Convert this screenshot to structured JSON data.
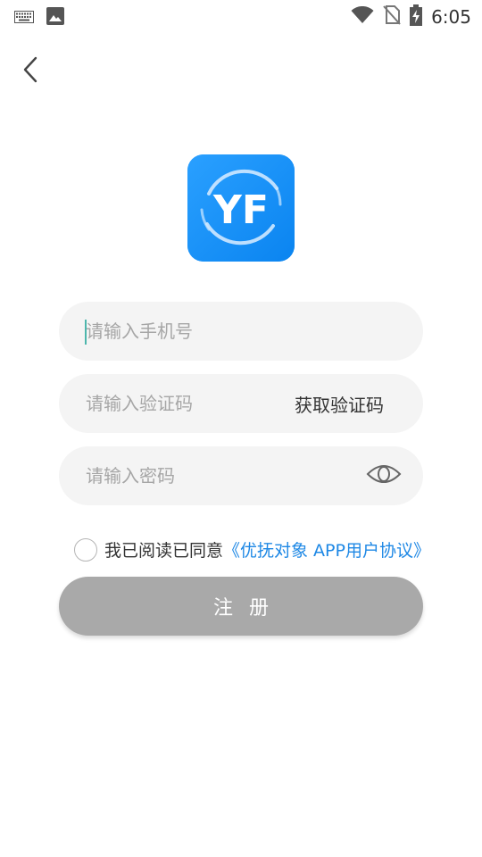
{
  "status_bar": {
    "time": "6:05",
    "icons": [
      "keyboard-icon",
      "image-icon",
      "wifi-icon",
      "no-sim-icon",
      "battery-charging-icon"
    ]
  },
  "nav": {
    "back_icon": "chevron-left-icon"
  },
  "logo": {
    "text": "YF",
    "bg_color": "#1e90f5"
  },
  "form": {
    "phone_placeholder": "请输入手机号",
    "code_placeholder": "请输入验证码",
    "get_code_label": "获取验证码",
    "password_placeholder": "请输入密码",
    "eye_icon": "eye-icon"
  },
  "agreement": {
    "prefix": "我已阅读已同意",
    "link_text": "《优抚对象 APP用户协议》",
    "link_color": "#1e88e5",
    "checked": false
  },
  "register": {
    "label": "注册",
    "bg_color": "#a9a9a9"
  }
}
